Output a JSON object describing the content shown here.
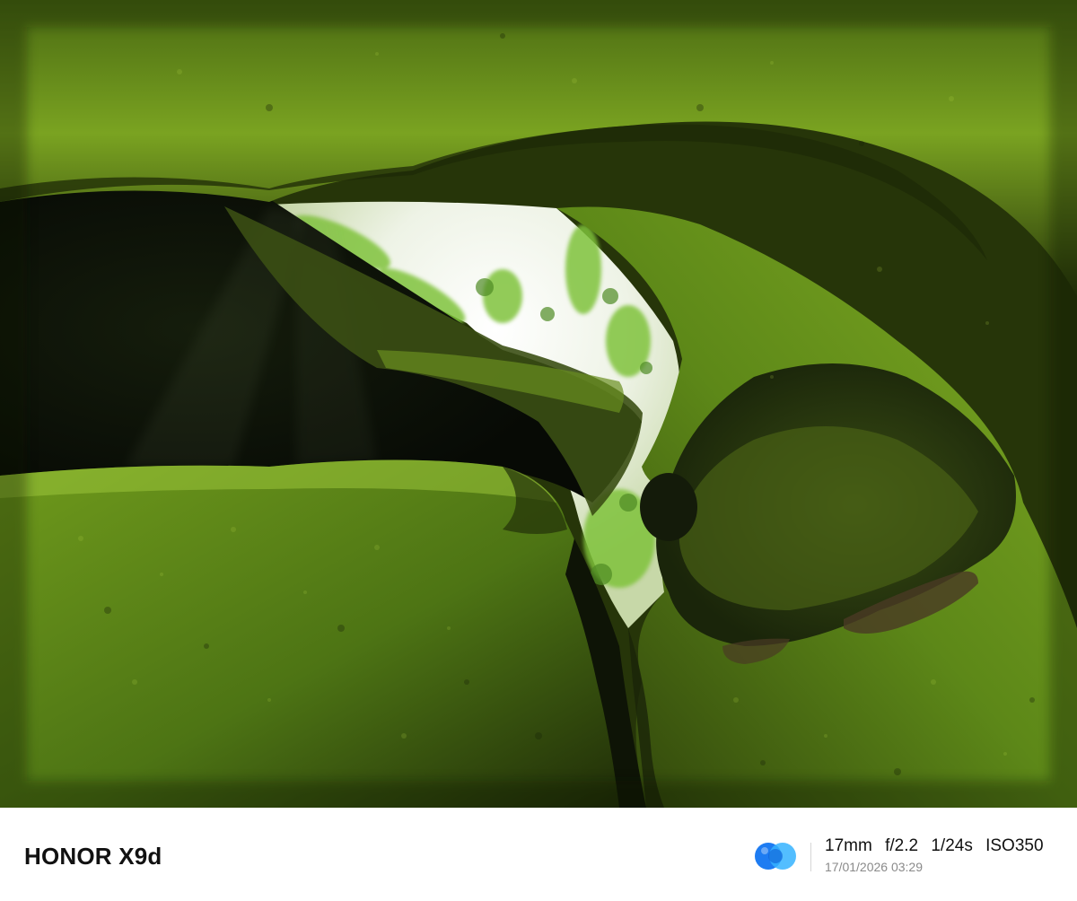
{
  "photo": {
    "subject": "photo",
    "colors": {
      "moss_light": "#8fbf2a",
      "moss_mid": "#5f8a18",
      "moss_dark": "#2c3d0a",
      "shadow": "#0d120a",
      "sky": "#f4f7f0"
    }
  },
  "footer": {
    "brand": "HONOR X9d",
    "logo_icon": "honor-camera-logo-icon",
    "specs": {
      "focal_length": "17mm",
      "aperture": "f/2.2",
      "shutter": "1/24s",
      "iso": "ISO350"
    },
    "datetime": "17/01/2026 03:29",
    "colors": {
      "logo_primary": "#1e7cf2",
      "logo_secondary": "#35b3ff"
    }
  }
}
